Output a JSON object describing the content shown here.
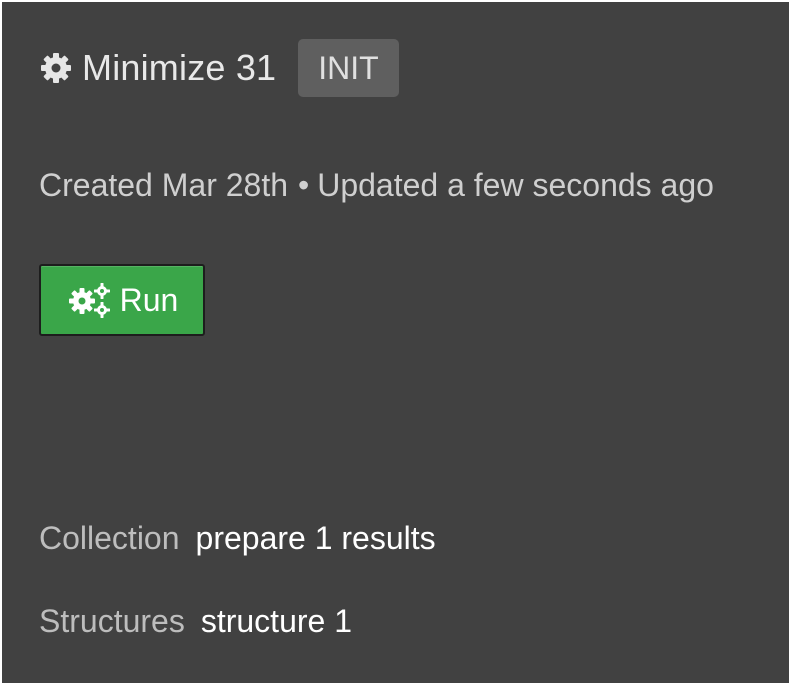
{
  "header": {
    "title": "Minimize 31",
    "status_badge": "INIT",
    "icon": "gear-icon"
  },
  "meta": {
    "created": "Created Mar 28th",
    "separator": "•",
    "updated": "Updated a few seconds ago"
  },
  "actions": {
    "run_label": "Run",
    "run_icon": "cogs-icon",
    "run_color": "#3aa649"
  },
  "fields": {
    "collection": {
      "label": "Collection",
      "value": "prepare 1 results"
    },
    "structures": {
      "label": "Structures",
      "value": "structure 1"
    }
  },
  "colors": {
    "background": "#414141",
    "badge_bg": "#5f5f5f"
  }
}
